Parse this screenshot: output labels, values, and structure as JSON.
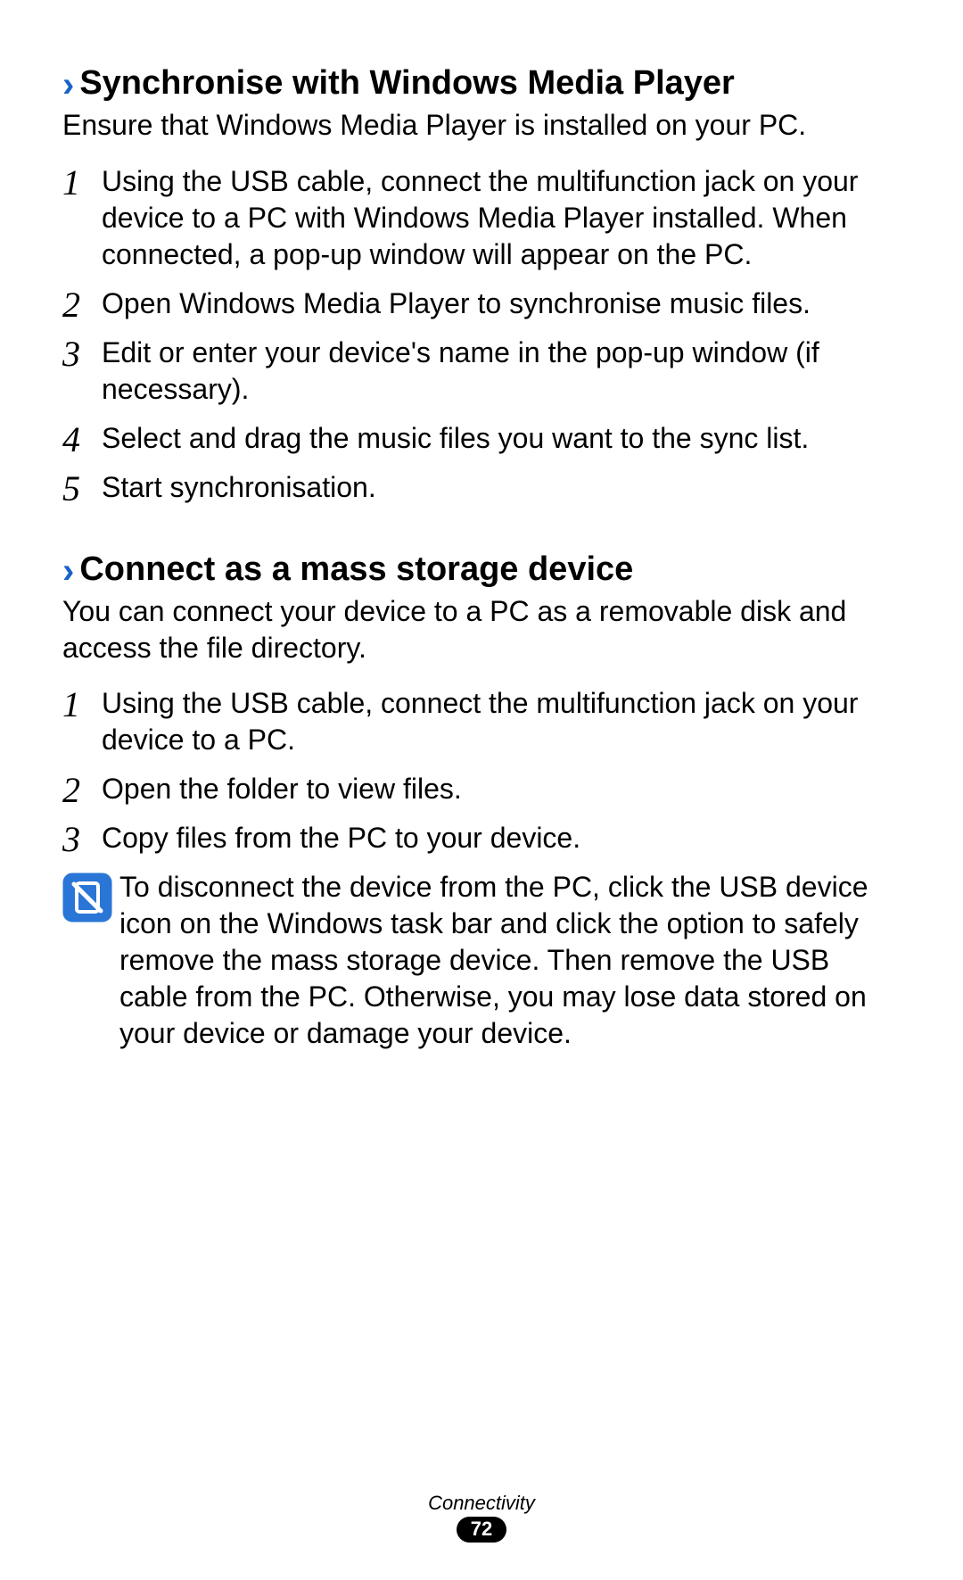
{
  "section1": {
    "title": "Synchronise with Windows Media Player",
    "intro": "Ensure that Windows Media Player is installed on your PC.",
    "steps": [
      "Using the USB cable, connect the multifunction jack on your device to a PC with Windows Media Player installed. When connected, a pop-up window will appear on the PC.",
      "Open Windows Media Player to synchronise music files.",
      "Edit or enter your device's name in the pop-up window (if necessary).",
      "Select and drag the music files you want to the sync list.",
      "Start synchronisation."
    ]
  },
  "section2": {
    "title": "Connect as a mass storage device",
    "intro": "You can connect your device to a PC as a removable disk and access the file directory.",
    "steps": [
      "Using the USB cable, connect the multifunction jack on your device to a PC.",
      "Open the folder to view files.",
      "Copy files from the PC to your device."
    ],
    "note": "To disconnect the device from the PC, click the USB device icon on the Windows task bar and click the option to safely remove the mass storage device. Then remove the USB cable from the PC. Otherwise, you may lose data stored on your device or damage your device."
  },
  "footer": {
    "label": "Connectivity",
    "page": "72"
  },
  "stepNumbers": [
    "1",
    "2",
    "3",
    "4",
    "5"
  ]
}
